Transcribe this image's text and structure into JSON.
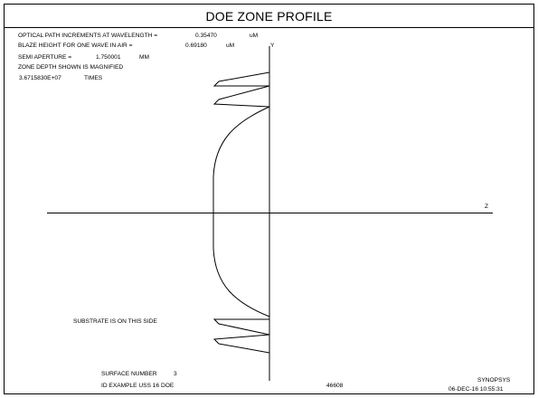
{
  "title": "DOE ZONE PROFILE",
  "params": {
    "opd_label": "OPTICAL PATH INCREMENTS AT WAVELENGTH =",
    "opd_value": "0.35470",
    "opd_unit": "uM",
    "blaze_label": "BLAZE HEIGHT FOR ONE WAVE IN AIR =",
    "blaze_value": "0.69180",
    "blaze_unit": "uM",
    "aperture_label": "SEMI APERTURE =",
    "aperture_value": "1.750001",
    "aperture_unit": "MM",
    "magnified_label": "ZONE DEPTH SHOWN IS MAGNIFIED",
    "magnified_value": "3.6715830E+07",
    "magnified_unit": "TIMES"
  },
  "axes": {
    "y_label": "Y",
    "z_label": "Z"
  },
  "substrate_note": "SUBSTRATE IS ON THIS SIDE",
  "footer": {
    "surface_label": "SURFACE NUMBER",
    "surface_value": "3",
    "example_label": "ID EXAMPLE USS 16 DOE",
    "code": "46608",
    "vendor": "SYNOPSYS",
    "timestamp": "06-DEC-16  10:55:31"
  }
}
